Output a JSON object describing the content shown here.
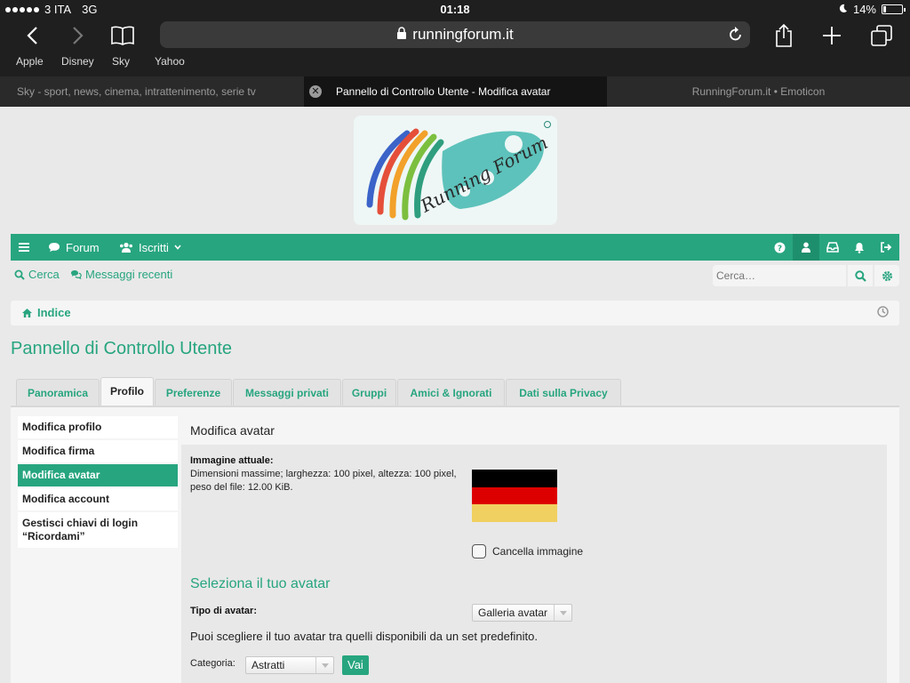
{
  "status": {
    "carrier": "3 ITA",
    "network": "3G",
    "time": "01:18",
    "battery": "14%",
    "battery_level": 0.14
  },
  "browser": {
    "url": "runningforum.it",
    "favorites": [
      "Apple",
      "Disney",
      "Sky",
      "Yahoo"
    ],
    "tabs": [
      {
        "label": "Sky - sport, news, cinema, intrattenimento, serie tv"
      },
      {
        "label": "Pannello di Controllo Utente - Modifica avatar"
      },
      {
        "label": "RunningForum.it • Emoticon"
      }
    ]
  },
  "nav": {
    "forum": "Forum",
    "members": "Iscritti"
  },
  "subnav": {
    "search": "Cerca",
    "recent": "Messaggi recenti",
    "search_placeholder": "Cerca…"
  },
  "breadcrumb": {
    "home": "Indice"
  },
  "page_title": "Pannello di Controllo Utente",
  "ucp_tabs": [
    "Panoramica",
    "Profilo",
    "Preferenze",
    "Messaggi privati",
    "Gruppi",
    "Amici & Ignorati",
    "Dati sulla Privacy"
  ],
  "menu": [
    "Modifica profilo",
    "Modifica firma",
    "Modifica avatar",
    "Modifica account",
    "Gestisci chiavi di login “Ricordami”"
  ],
  "content": {
    "title": "Modifica avatar",
    "current_label": "Immagine attuale:",
    "current_desc": "Dimensioni massime; larghezza: 100 pixel, altezza: 100 pixel, peso del file: 12.00 KiB.",
    "delete_label": "Cancella immagine",
    "select_heading": "Seleziona il tuo avatar",
    "type_label": "Tipo di avatar:",
    "type_value": "Galleria avatar",
    "type_desc": "Puoi scegliere il tuo avatar tra quelli disponibili da un set predefinito.",
    "category_label": "Categoria:",
    "category_value": "Astratti",
    "go_label": "Vai"
  },
  "colors": {
    "accent": "#27a57f",
    "flag_black": "#000000",
    "flag_red": "#dd0000",
    "flag_gold": "#f0d060"
  }
}
